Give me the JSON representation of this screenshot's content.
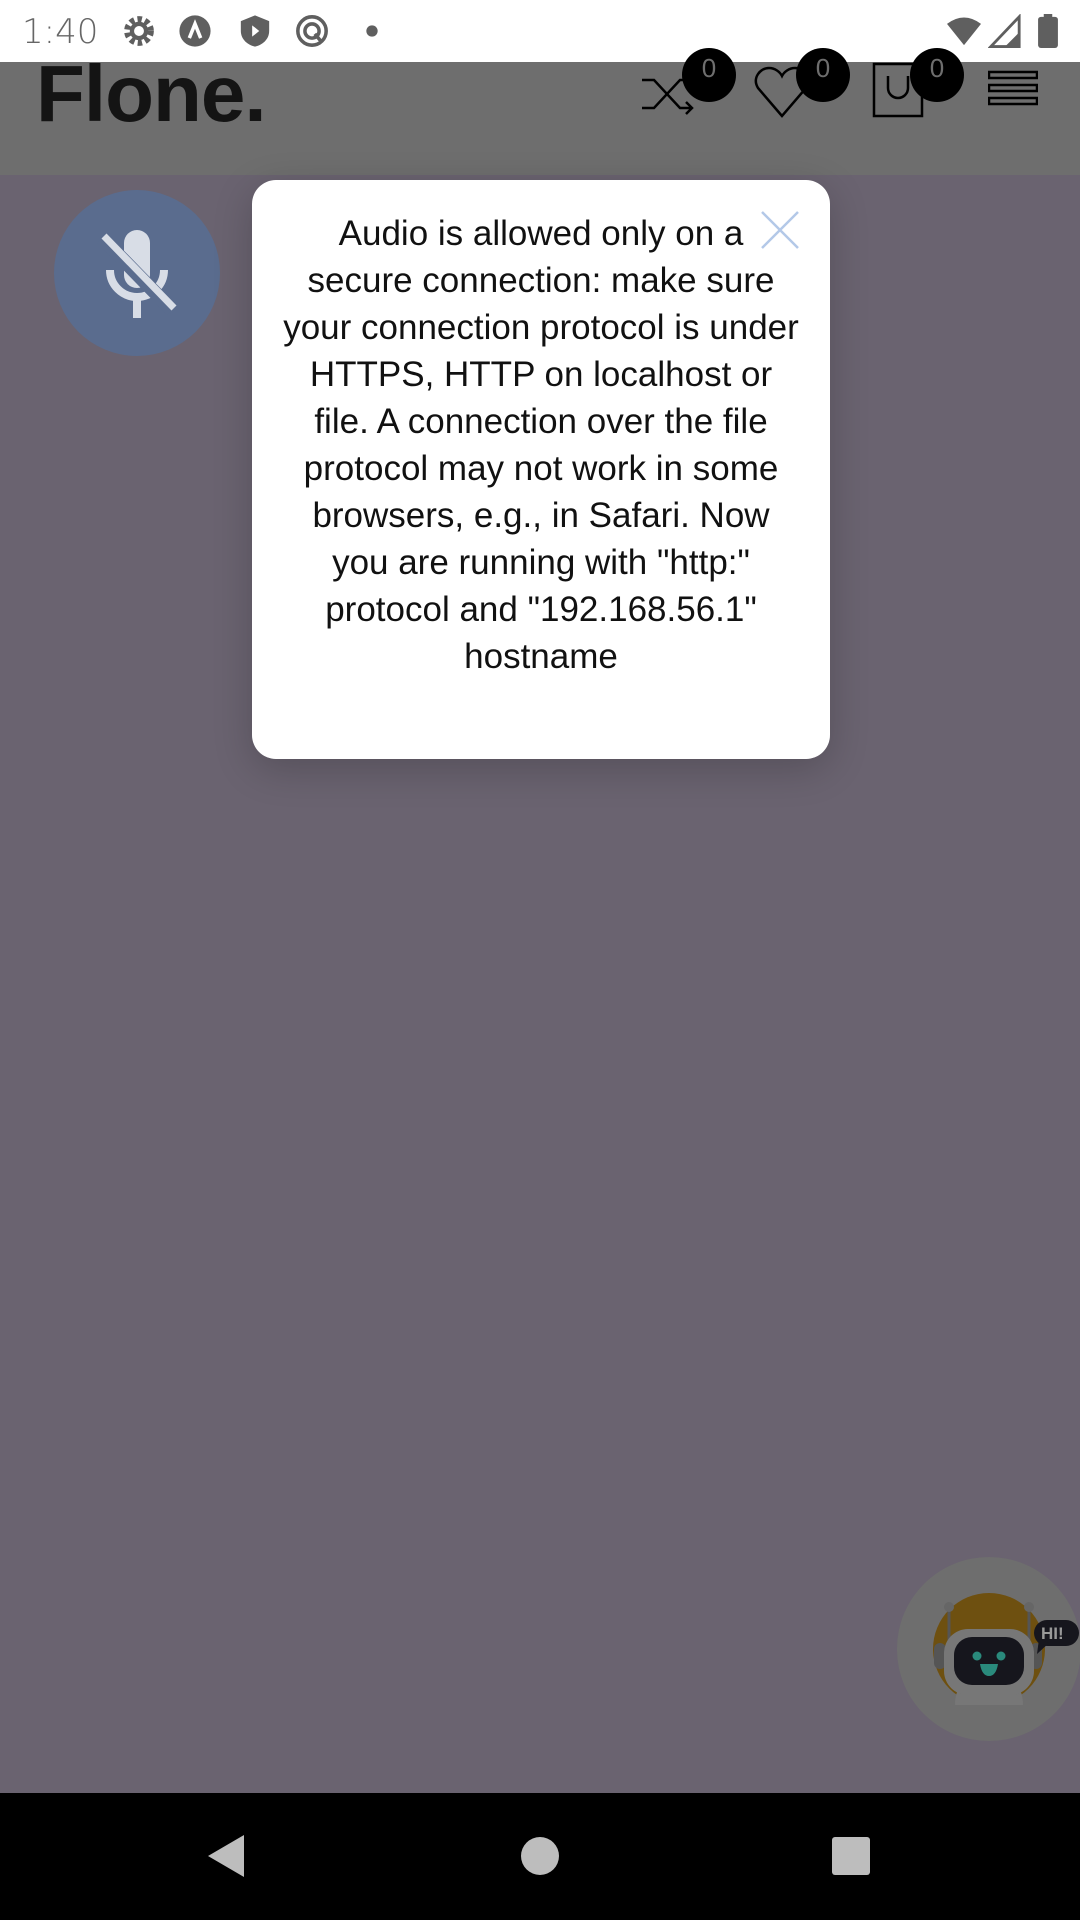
{
  "status_bar": {
    "time": "1:40",
    "icons": [
      "settings-icon",
      "app-a-icon",
      "shield-play-icon",
      "at-circle-icon",
      "dot-icon",
      "wifi-icon",
      "signal-icon",
      "battery-icon"
    ]
  },
  "header": {
    "logo": "Flone.",
    "compare_count": "0",
    "wishlist_count": "0",
    "cart_count": "0"
  },
  "dialog": {
    "message": "Audio is allowed only on a secure connection: make sure your connection protocol is under HTTPS, HTTP on localhost or file. A connection over the file protocol may not work in some browsers, e.g., in Safari. Now you are running with \"http:\" protocol and \"192.168.56.1\" hostname"
  },
  "chatbot": {
    "bubble": "HI!"
  },
  "colors": {
    "overlay": "#6a6370",
    "mic_button": "#5a6c8e",
    "chatbot_ring": "#6e5010"
  }
}
